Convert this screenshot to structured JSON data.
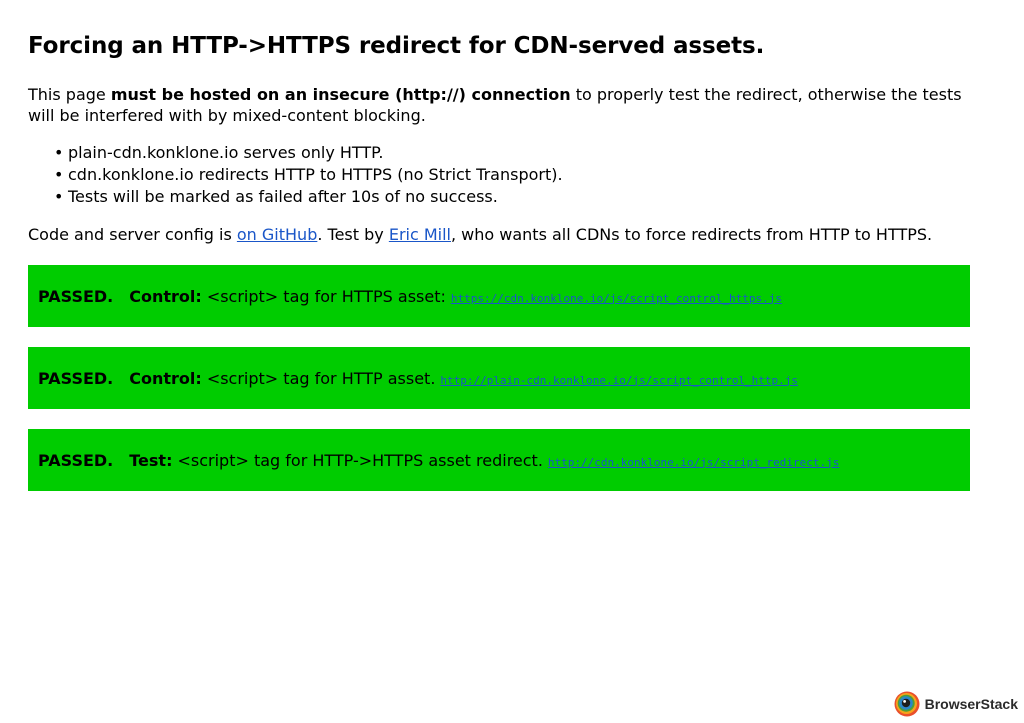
{
  "heading": "Forcing an HTTP->HTTPS redirect for CDN-served assets.",
  "intro": {
    "prefix": "This page ",
    "emphasis": "must be hosted on an insecure (http://) connection",
    "suffix": " to properly test the redirect, otherwise the tests will be interfered with by mixed-content blocking."
  },
  "bullets": [
    "plain-cdn.konklone.io serves only HTTP.",
    "cdn.konklone.io redirects HTTP to HTTPS (no Strict Transport).",
    "Tests will be marked as failed after 10s of no success."
  ],
  "credits": {
    "part1": "Code and server config is ",
    "github_link": "on GitHub",
    "part2": ". Test by ",
    "author_link": "Eric Mill",
    "part3": ", who wants all CDNs to force redirects from HTTP to HTTPS."
  },
  "results": [
    {
      "status": "PASSED.",
      "kind": "Control:",
      "description": "<script> tag for HTTPS asset:",
      "asset": "https://cdn.konklone.io/js/script_control_https.js"
    },
    {
      "status": "PASSED.",
      "kind": "Control:",
      "description": "<script> tag for HTTP asset.",
      "asset": "http://plain-cdn.konklone.io/js/script_control_http.js"
    },
    {
      "status": "PASSED.",
      "kind": "Test:",
      "description": "<script> tag for HTTP->HTTPS asset redirect.",
      "asset": "http://cdn.konklone.io/js/script_redirect.js"
    }
  ],
  "badge": {
    "label": "BrowserStack",
    "icon": "browserstack-logo-icon"
  },
  "colors": {
    "passed_background": "#00cc00",
    "link": "#1a56c8",
    "text": "#000000"
  }
}
